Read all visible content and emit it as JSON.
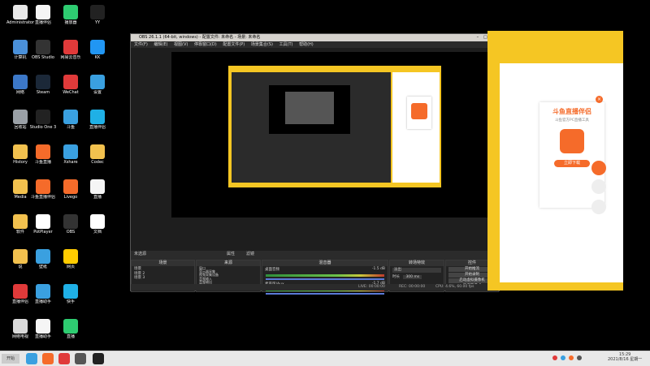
{
  "desktop": {
    "icons": [
      {
        "label": "Administrator",
        "color": "#e8e8e8"
      },
      {
        "label": "计算机",
        "color": "#4a90d9"
      },
      {
        "label": "网络",
        "color": "#3c78c8"
      },
      {
        "label": "回收站",
        "color": "#9aa0a6"
      },
      {
        "label": "History",
        "color": "#f2c14e"
      },
      {
        "label": "Media",
        "color": "#f2c14e"
      },
      {
        "label": "软件",
        "color": "#f2c14e"
      },
      {
        "label": "说",
        "color": "#f2c14e"
      },
      {
        "label": "直播伴侣",
        "color": "#e03a3a"
      },
      {
        "label": "网络电视",
        "color": "#d9d9d9"
      },
      {
        "label": "直播伴侣",
        "color": "#f5f5f5"
      },
      {
        "label": "OBS Studio",
        "color": "#333"
      },
      {
        "label": "Steam",
        "color": "#1b2838"
      },
      {
        "label": "Studio One 3",
        "color": "#222"
      },
      {
        "label": "斗鱼直播",
        "color": "#f56b2a"
      },
      {
        "label": "斗鱼直播伴侣",
        "color": "#f56b2a"
      },
      {
        "label": "PotPlayer",
        "color": "#fff"
      },
      {
        "label": "壁纸",
        "color": "#3aa0e0"
      },
      {
        "label": "直播助手",
        "color": "#3aa0e0"
      },
      {
        "label": "直播助手",
        "color": "#f5f5f5"
      },
      {
        "label": "播放器",
        "color": "#2ecc71"
      },
      {
        "label": "网易云音乐",
        "color": "#e03a3a"
      },
      {
        "label": "WeChat",
        "color": "#e03a3a"
      },
      {
        "label": "斗鱼",
        "color": "#3aa0e0"
      },
      {
        "label": "Xshare",
        "color": "#3aa0e0"
      },
      {
        "label": "Livego",
        "color": "#f56b2a"
      },
      {
        "label": "OBS",
        "color": "#333"
      },
      {
        "label": "网页",
        "color": "#ffcc00"
      },
      {
        "label": "快手",
        "color": "#1fb0e6"
      },
      {
        "label": "直播",
        "color": "#2ecc71"
      },
      {
        "label": "YY",
        "color": "#222"
      },
      {
        "label": "KK",
        "color": "#2196f3"
      },
      {
        "label": "设置",
        "color": "#3aa0e0"
      },
      {
        "label": "直播伴侣",
        "color": "#1fb0e6"
      },
      {
        "label": "Codec",
        "color": "#f2c14e"
      },
      {
        "label": "直播",
        "color": "#f5f5f5"
      },
      {
        "label": "文档",
        "color": "#fff"
      }
    ]
  },
  "obs": {
    "title": "OBS 26.1.1 (64-bit, windows) - 配置文件: 未命名 - 场景: 未命名",
    "menus": [
      "文件(F)",
      "编辑(E)",
      "视图(V)",
      "停靠窗口(D)",
      "配置文件(P)",
      "场景集合(S)",
      "工具(T)",
      "帮助(H)"
    ],
    "scene_status": "未选源",
    "scene_props": "属性",
    "scene_filters": "滤镜",
    "docks": {
      "scenes": {
        "title": "场景",
        "items": [
          "场景",
          "场景 2",
          "场景 3"
        ]
      },
      "sources": {
        "title": "来源",
        "items": [
          "窗口",
          "显示器采集",
          "视频采集设备",
          "音频输入",
          "音频输出",
          "图像",
          "文本"
        ]
      },
      "mixer": {
        "title": "混音器",
        "tracks": [
          {
            "name": "桌面音频",
            "db": "-1.5 dB"
          },
          {
            "name": "麦克风/Aux",
            "db": "-1.7 dB"
          }
        ]
      },
      "transitions": {
        "title": "转场特效",
        "type": "淡出",
        "duration_label": "时长",
        "duration": "300 ms"
      },
      "controls": {
        "title": "控件",
        "buttons": [
          "开始推流",
          "开始录制",
          "启动虚拟摄像机",
          "工作室模式",
          "设置",
          "退出"
        ]
      }
    },
    "status": {
      "live": "LIVE: 00:00:00",
      "rec": "REC: 00:00:00",
      "cpu": "CPU: 4.6%, 60.00 fps"
    }
  },
  "browser": {
    "promo_title": "斗鱼直播伴侣",
    "promo_sub": "斗鱼官方PC直播工具",
    "promo_button": "立即下载"
  },
  "taskbar": {
    "start": "开始",
    "time": "15:29",
    "date": "2021/8/16 星期一"
  }
}
